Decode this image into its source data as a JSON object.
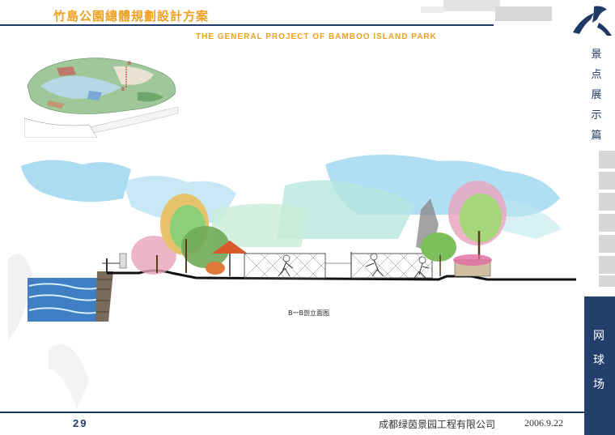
{
  "header": {
    "title_cn": "竹島公園總體規劃設計方案",
    "title_en": "THE GENERAL PROJECT OF BAMBOO ISLAND PARK"
  },
  "sidebar": {
    "category_title": "景\n点\n展\n示\n篇",
    "section_title": "网\n球\n场"
  },
  "key_plan": {
    "marker_label": "B",
    "marker_label_2": "B"
  },
  "drawing": {
    "caption": "B一B剖立面图"
  },
  "footer": {
    "page_number": "29",
    "company": "成都绿茵景园工程有限公司",
    "date": "2006.9.22"
  },
  "colors": {
    "navy": "#1f3a66",
    "title_orange": "#f0a020",
    "panel_blue": "#233f6b"
  }
}
